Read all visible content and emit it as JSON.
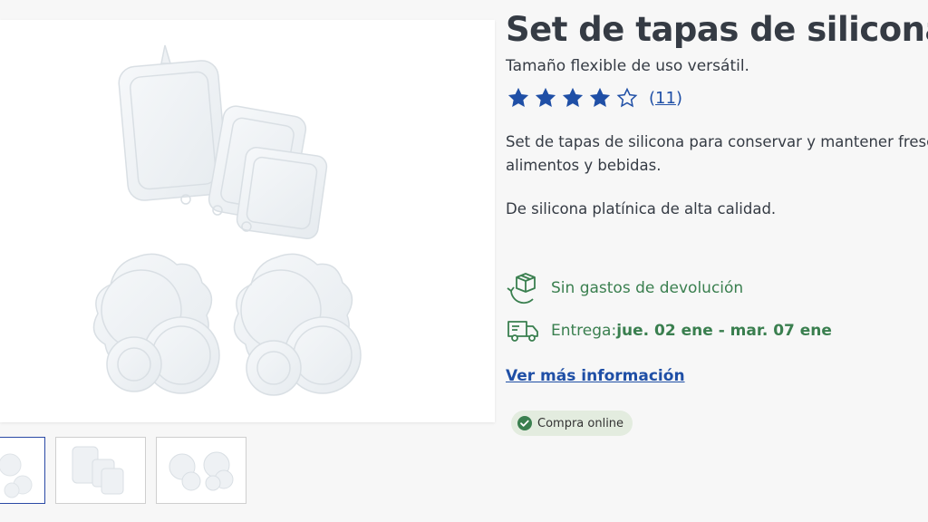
{
  "product": {
    "title": "Set de tapas de silicona",
    "subtitle": "Tamaño flexible de uso versátil.",
    "rating": {
      "stars": 4,
      "max": 5,
      "count_open": "(",
      "count": "11",
      "count_close": ")"
    },
    "description": [
      "Set de tapas de silicona para conservar y mantener fresc",
      "alimentos y bebidas."
    ],
    "description2": "De silicona platínica de alta calidad."
  },
  "features": {
    "returns": {
      "icon": "box-return-icon",
      "label": "Sin gastos de devolución"
    },
    "delivery": {
      "icon": "truck-icon",
      "label": "Entrega: ",
      "dates": "jue. 02 ene - mar. 07 ene"
    }
  },
  "more_link": "Ver más información",
  "badge": {
    "icon": "check-circle-icon",
    "label": "Compra online"
  },
  "colors": {
    "star": "#1f4fa6",
    "link": "#1f4fa6",
    "green": "#3a7f4f",
    "badge_bg": "#e3ecdf"
  },
  "gallery": {
    "thumbnails": [
      "thumb-1",
      "thumb-2",
      "thumb-3"
    ],
    "active_index": 0
  }
}
